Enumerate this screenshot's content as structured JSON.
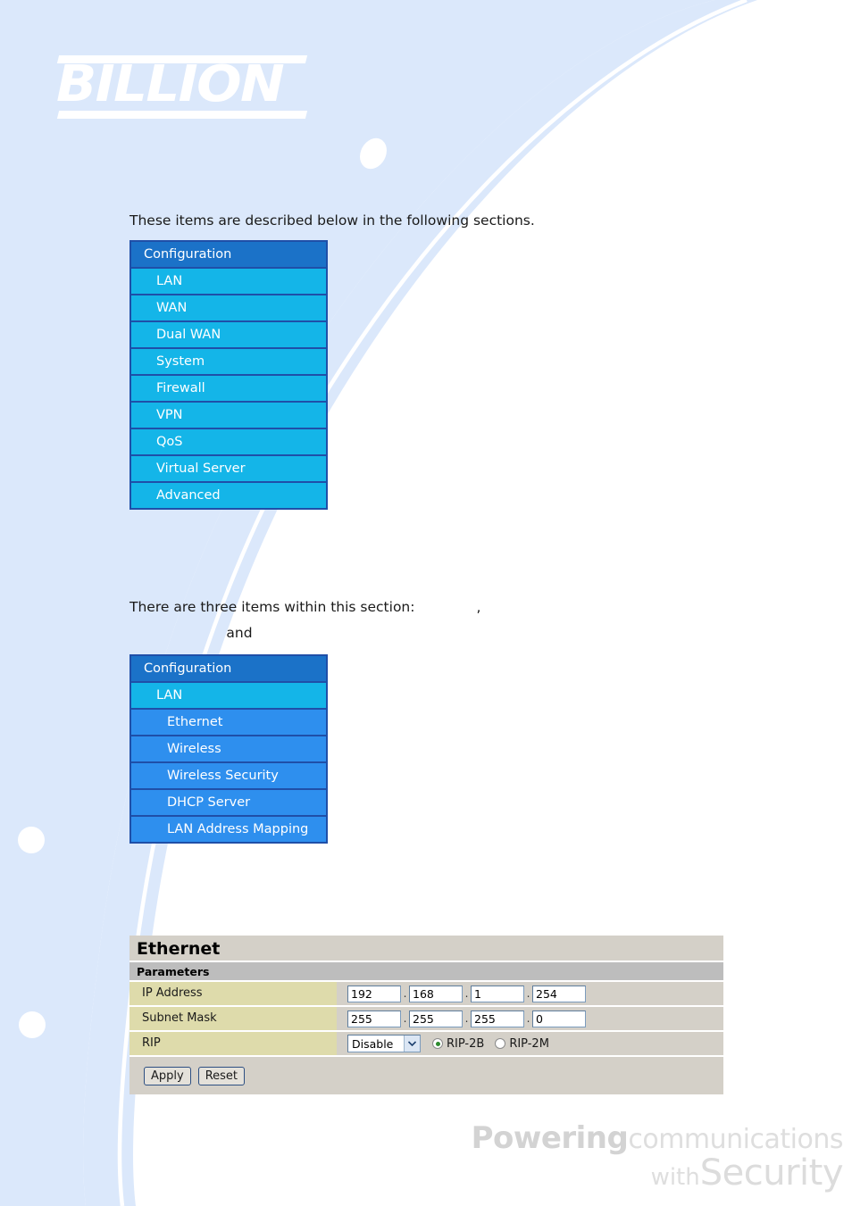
{
  "brand": {
    "logo_text": "BILLION"
  },
  "body": {
    "paragraph_1": "These items are described below in the following sections.",
    "paragraph_2_visible": "There are three items within this section:",
    "paragraph_2_comma": ",",
    "paragraph_3_visible": "and"
  },
  "menu_primary": {
    "header": "Configuration",
    "items": [
      {
        "label": "LAN",
        "level": 1
      },
      {
        "label": "WAN",
        "level": 1
      },
      {
        "label": "Dual WAN",
        "level": 1
      },
      {
        "label": "System",
        "level": 1
      },
      {
        "label": "Firewall",
        "level": 1
      },
      {
        "label": "VPN",
        "level": 1
      },
      {
        "label": "QoS",
        "level": 1
      },
      {
        "label": "Virtual Server",
        "level": 1
      },
      {
        "label": "Advanced",
        "level": 1
      }
    ]
  },
  "menu_secondary": {
    "header": "Configuration",
    "items": [
      {
        "label": "LAN",
        "level": 1
      },
      {
        "label": "Ethernet",
        "level": 2
      },
      {
        "label": "Wireless",
        "level": 2
      },
      {
        "label": "Wireless Security",
        "level": 2
      },
      {
        "label": "DHCP Server",
        "level": 2
      },
      {
        "label": "LAN Address Mapping",
        "level": 2
      }
    ]
  },
  "panel": {
    "title": "Ethernet",
    "section": "Parameters",
    "rows": {
      "ip_address": {
        "label": "IP Address",
        "octets": [
          "192",
          "168",
          "1",
          "254"
        ]
      },
      "subnet_mask": {
        "label": "Subnet Mask",
        "octets": [
          "255",
          "255",
          "255",
          "0"
        ]
      },
      "rip": {
        "label": "RIP",
        "select_value": "Disable",
        "select_options": [
          "Disable"
        ],
        "radios": [
          {
            "label": "RIP-2B",
            "selected": true
          },
          {
            "label": "RIP-2M",
            "selected": false
          }
        ]
      }
    },
    "buttons": {
      "apply": "Apply",
      "reset": "Reset"
    },
    "separator": "."
  },
  "footer": {
    "word_powering": "Powering",
    "word_communications": "communications",
    "word_with": "with",
    "word_security": "Security"
  },
  "colors": {
    "menu_header": "#1b72c8",
    "menu_level1": "#14b5e8",
    "menu_level2": "#2e8fee",
    "menu_border": "#1f4fa8",
    "panel_bg": "#d4d0c8",
    "panel_section": "#bdbdbd",
    "panel_label": "#dedbab",
    "radio_selected": "#2e8b2e",
    "page_bg_blue": "#dbe8fb"
  }
}
